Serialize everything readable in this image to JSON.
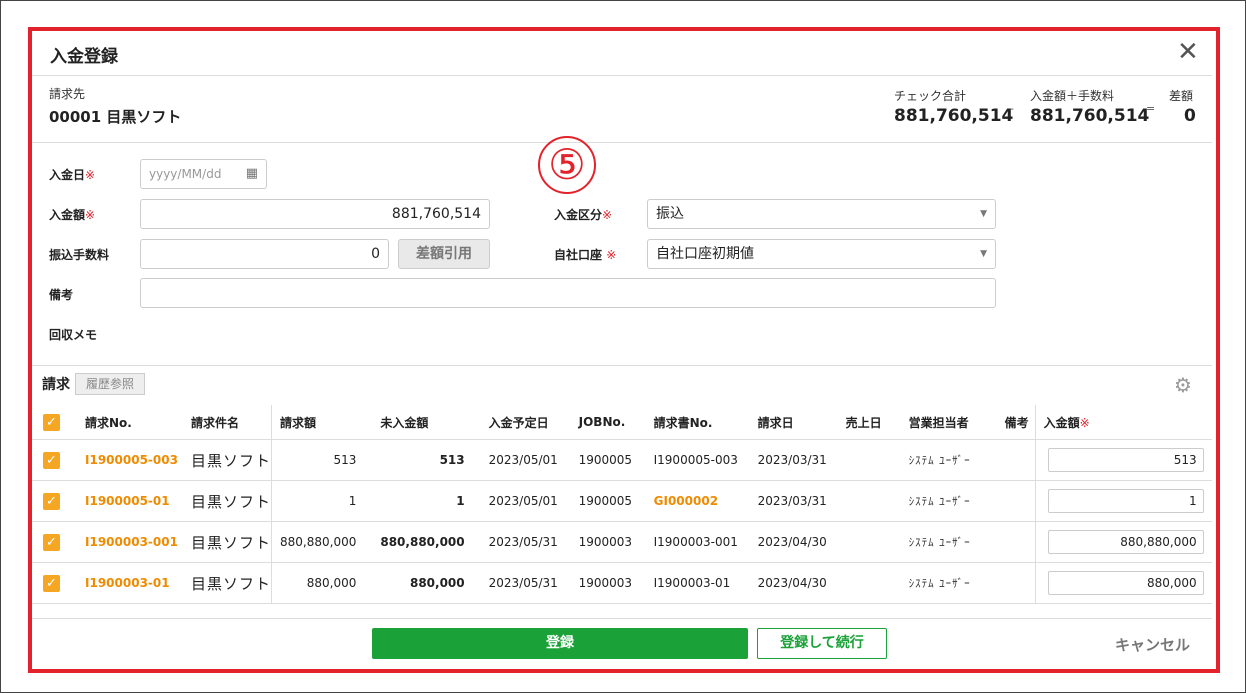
{
  "dialog": {
    "title": "入金登録",
    "close": "✕"
  },
  "customer": {
    "label": "請求先",
    "value": "00001 目黒ソフト"
  },
  "summary": {
    "check_label": "チェック合計",
    "check_value": "881,760,514",
    "minus": "-",
    "deposit_label": "入金額＋手数料",
    "deposit_value": "881,760,514",
    "equals": "=",
    "diff_label": "差額",
    "diff_value": "0"
  },
  "annotation": "⑤",
  "form": {
    "date_label": "入金日",
    "required_mark": "※",
    "date_placeholder": "yyyy/MM/dd",
    "amount_label": "入金額",
    "amount_value": "881,760,514",
    "type_label": "入金区分",
    "type_value": "振込",
    "fee_label": "振込手数料",
    "fee_value": "0",
    "diff_button": "差額引用",
    "account_label": "自社口座",
    "account_value": "自社口座初期値",
    "note_label": "備考",
    "note_value": "",
    "memo_label": "回収メモ"
  },
  "section": {
    "title": "請求",
    "history_button": "履歴参照"
  },
  "table": {
    "headers": [
      "請求No.",
      "請求件名",
      "請求額",
      "未入金額",
      "入金予定日",
      "JOBNo.",
      "請求書No.",
      "請求日",
      "売上日",
      "営業担当者",
      "備考",
      "入金額"
    ],
    "rows": [
      {
        "no": "I1900005-003",
        "name": "目黒ソフト",
        "amount": "513",
        "unpaid": "513",
        "due": "2023/05/01",
        "job": "1900005",
        "invoice": "I1900005-003",
        "invoice_link": false,
        "date": "2023/03/31",
        "sales": "",
        "rep": "ｼｽﾃﾑ ﾕｰｻﾞｰ",
        "note": "",
        "deposit": "513"
      },
      {
        "no": "I1900005-01",
        "name": "目黒ソフト",
        "amount": "1",
        "unpaid": "1",
        "due": "2023/05/01",
        "job": "1900005",
        "invoice": "GI000002",
        "invoice_link": true,
        "date": "2023/03/31",
        "sales": "",
        "rep": "ｼｽﾃﾑ ﾕｰｻﾞｰ",
        "note": "",
        "deposit": "1"
      },
      {
        "no": "I1900003-001",
        "name": "目黒ソフト",
        "amount": "880,880,000",
        "unpaid": "880,880,000",
        "due": "2023/05/31",
        "job": "1900003",
        "invoice": "I1900003-001",
        "invoice_link": false,
        "date": "2023/04/30",
        "sales": "",
        "rep": "ｼｽﾃﾑ ﾕｰｻﾞｰ",
        "note": "",
        "deposit": "880,880,000"
      },
      {
        "no": "I1900003-01",
        "name": "目黒ソフト",
        "amount": "880,000",
        "unpaid": "880,000",
        "due": "2023/05/31",
        "job": "1900003",
        "invoice": "I1900003-01",
        "invoice_link": false,
        "date": "2023/04/30",
        "sales": "",
        "rep": "ｼｽﾃﾑ ﾕｰｻﾞｰ",
        "note": "",
        "deposit": "880,000"
      }
    ]
  },
  "footer": {
    "register": "登録",
    "register_continue": "登録して続行",
    "cancel": "キャンセル"
  },
  "colors": {
    "accent_green": "#1aa137",
    "link_orange": "#f08b00",
    "checkbox": "#f5a623",
    "highlight_red": "#e3232c"
  }
}
